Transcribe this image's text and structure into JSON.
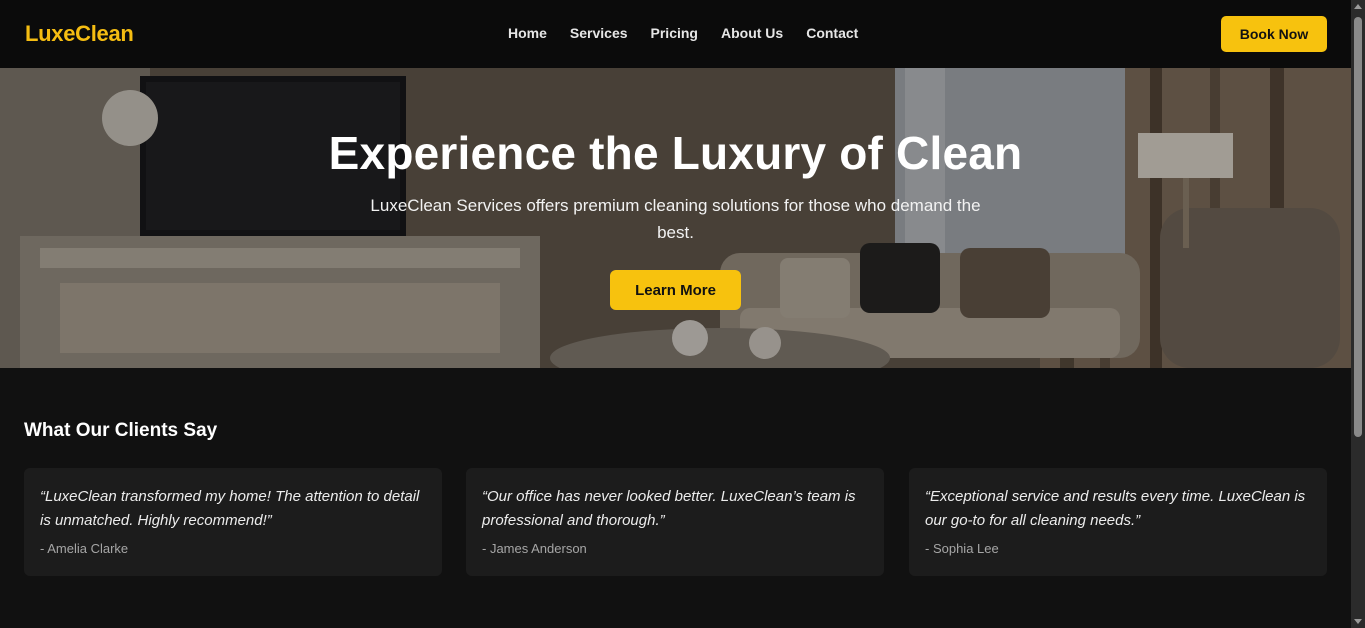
{
  "brand": {
    "name": "LuxeClean",
    "accent": "#f7c20e"
  },
  "nav": {
    "links": [
      "Home",
      "Services",
      "Pricing",
      "About Us",
      "Contact"
    ],
    "cta": "Book Now"
  },
  "hero": {
    "title": "Experience the Luxury of Clean",
    "subtitle": "LuxeClean Services offers premium cleaning solutions for those who demand the best.",
    "button": "Learn More"
  },
  "testimonials": {
    "heading": "What Our Clients Say",
    "items": [
      {
        "quote": "“LuxeClean transformed my home! The attention to detail is unmatched. Highly recommend!”",
        "author": "- Amelia Clarke"
      },
      {
        "quote": "“Our office has never looked better. LuxeClean’s team is professional and thorough.”",
        "author": "- James Anderson"
      },
      {
        "quote": "“Exceptional service and results every time. LuxeClean is our go-to for all cleaning needs.”",
        "author": "- Sophia Lee"
      }
    ]
  }
}
